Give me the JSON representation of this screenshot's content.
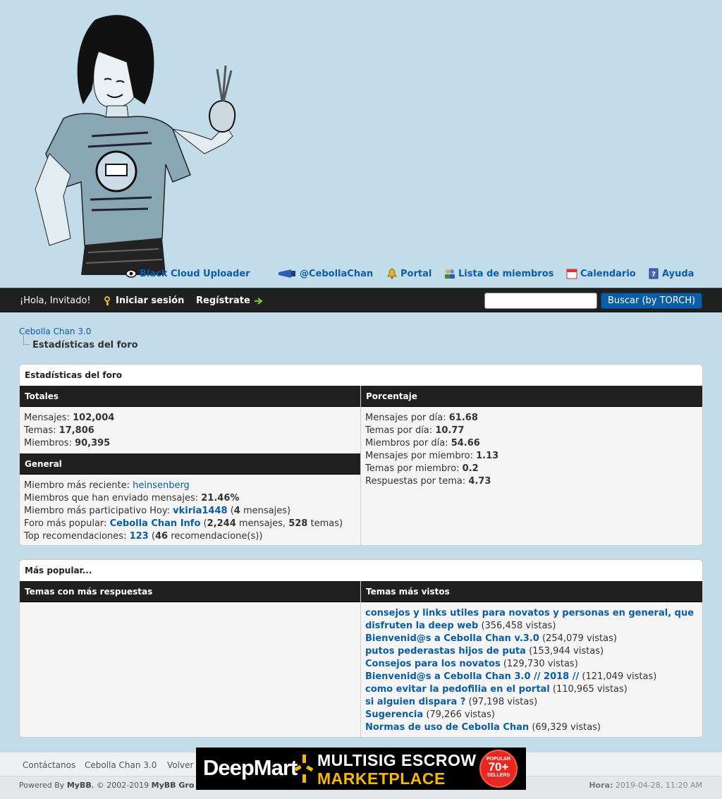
{
  "header": {
    "top_links": {
      "uploader": "Black Cloud Uploader",
      "twitter": "@CebollaChan",
      "portal": "Portal",
      "members": "Lista de miembros",
      "calendar": "Calendario",
      "help": "Ayuda"
    }
  },
  "panel": {
    "greeting": "¡Hola, Invitado!",
    "login": "Iniciar sesión",
    "register": "Regístrate",
    "search_button": "Buscar (by TORCH)"
  },
  "breadcrumb": {
    "root": "Cebolla Chan 3.0",
    "current": "Estadísticas del foro"
  },
  "stats": {
    "title": "Estadísticas del foro",
    "totals": {
      "header": "Totales",
      "posts_label": "Mensajes:",
      "posts": "102,004",
      "threads_label": "Temas:",
      "threads": "17,806",
      "members_label": "Miembros:",
      "members": "90,395"
    },
    "general": {
      "header": "General",
      "newest_label": "Miembro más reciente:",
      "newest": "heinsenberg",
      "posters_label": "Miembros que han enviado mensajes:",
      "posters": "21.46%",
      "top_today_label": "Miembro más participativo Hoy:",
      "top_today": "vkiria1448",
      "top_today_count": "4",
      "top_today_suffix": "mensajes)",
      "popular_forum_label": "Foro más popular:",
      "popular_forum": "Cebolla Chan Info",
      "popular_forum_posts": "2,244",
      "popular_forum_posts_label": "mensajes,",
      "popular_forum_threads": "528",
      "popular_forum_threads_label": "temas)",
      "top_rep_label": "Top recomendaciones:",
      "top_rep": "123",
      "top_rep_count": "46",
      "top_rep_suffix": "recomendacione(s))"
    },
    "averages": {
      "header": "Porcentaje",
      "items": [
        {
          "label": "Mensajes por día:",
          "value": "61.68"
        },
        {
          "label": "Temas por día:",
          "value": "10.77"
        },
        {
          "label": "Miembros por día:",
          "value": "54.66"
        },
        {
          "label": "Mensajes por miembro:",
          "value": "1.13"
        },
        {
          "label": "Temas por miembro:",
          "value": "0.2"
        },
        {
          "label": "Respuestas por tema:",
          "value": "4.73"
        }
      ]
    }
  },
  "popular": {
    "title": "Más popular...",
    "most_replied_header": "Temas con más respuestas",
    "most_viewed_header": "Temas más vistos",
    "most_viewed": [
      {
        "title": "consejos y links utiles para novatos y personas en general, que disfruten la deep web",
        "views": "(356,458 vistas)"
      },
      {
        "title": "Bienvenid@s a Cebolla Chan v.3.0",
        "views": "(254,079 vistas)"
      },
      {
        "title": "putos pederastas hijos de puta",
        "views": "(153,944 vistas)"
      },
      {
        "title": "Consejos para los novatos",
        "views": "(129,730 vistas)"
      },
      {
        "title": "Bienvenid@s a Cebolla Chan 3.0 // 2018 //",
        "views": "(121,049 vistas)"
      },
      {
        "title": "como evitar la pedofilia en el portal",
        "views": "(110,965 vistas)"
      },
      {
        "title": "si alguien dispara ?",
        "views": "(97,198 vistas)"
      },
      {
        "title": "Sugerencia",
        "views": "(79,266 vistas)"
      },
      {
        "title": "Normas de uso de Cebolla Chan",
        "views": "(69,329 vistas)"
      }
    ]
  },
  "footer": {
    "contact": "Contáctanos",
    "site": "Cebolla Chan 3.0",
    "back": "Volver",
    "powered_prefix": "Powered By",
    "powered_mybb": "MyBB",
    "powered_mid": ", © 2002-2019",
    "powered_group": "MyBB Gro",
    "hora_label": "Hora:",
    "hora_value": "2019-04-28, 11:20 AM"
  },
  "banner": {
    "brand": "DeepMart",
    "line1": "MULTISIG ESCROW",
    "line2": "MARKETPLACE",
    "badge_top": "POPULAR",
    "badge_num": "70+",
    "badge_bottom": "SELLERS"
  }
}
